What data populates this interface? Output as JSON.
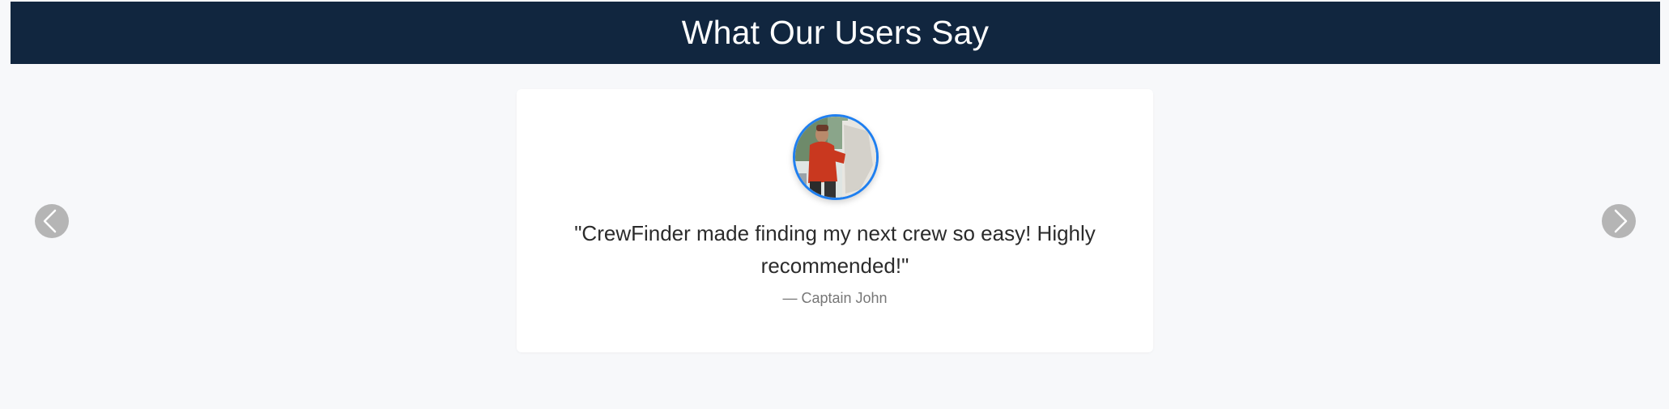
{
  "header": {
    "title": "What Our Users Say"
  },
  "testimonial": {
    "quote": "\"CrewFinder made finding my next crew so easy! Highly recommended!\"",
    "author": "— Captain John",
    "avatar_icon": "user-photo"
  },
  "carousel": {
    "prev_icon": "chevron-left-icon",
    "next_icon": "chevron-right-icon"
  },
  "colors": {
    "header_bg": "#11263f",
    "page_bg": "#f7f8fa",
    "avatar_border": "#1f7ff0",
    "arrow_bg": "#b5b5b5"
  }
}
